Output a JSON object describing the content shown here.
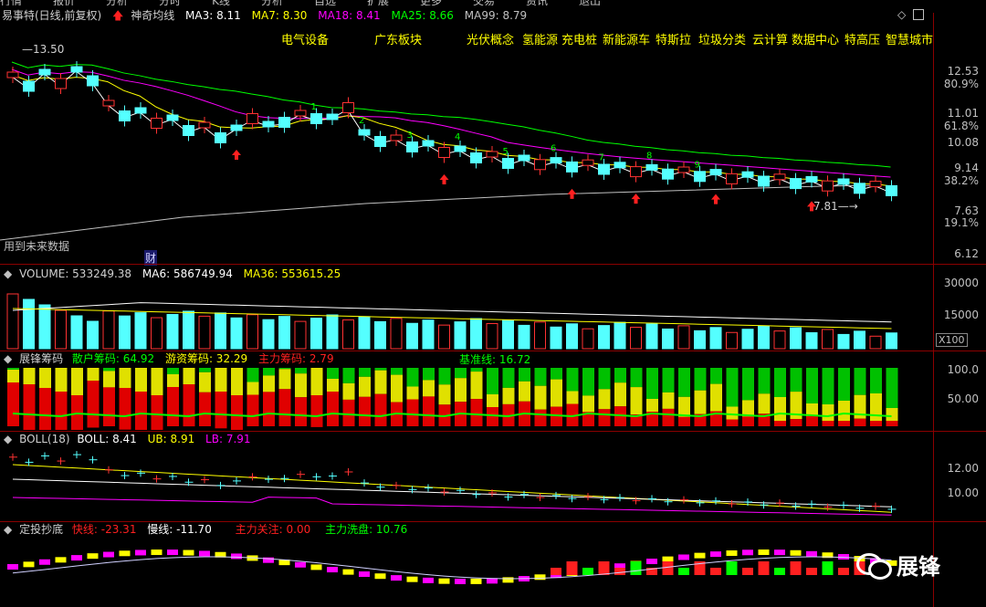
{
  "top_menu": [
    "行情",
    "报价",
    "分析",
    "分时",
    "K线",
    "分析",
    "自选",
    "扩展",
    "更多",
    "交易",
    "资讯",
    "退出"
  ],
  "main": {
    "stock": "易事特(日线,前复权)",
    "indicator": "神奇均线",
    "ma3": "MA3: 8.11",
    "ma7": "MA7: 8.30",
    "ma18": "MA18: 8.41",
    "ma25": "MA25: 8.66",
    "ma99": "MA99: 8.79",
    "high_label": "13.50",
    "low_label": "7.81",
    "future_label": "用到未来数据",
    "fin_label": "财",
    "concepts": [
      "电气设备",
      "广东板块",
      "光伏概念",
      "氢能源",
      "充电桩",
      "新能源车",
      "特斯拉",
      "垃圾分类",
      "云计算",
      "数据中心",
      "特高压",
      "智慧城市"
    ],
    "right_axis": [
      "12.53",
      "80.9%",
      "11.01",
      "61.8%",
      "10.08",
      "9.14",
      "38.2%",
      "7.63",
      "19.1%",
      "6.12"
    ]
  },
  "volume": {
    "title": "VOLUME: 533249.38",
    "ma6": "MA6: 586749.94",
    "ma36": "MA36: 553615.25",
    "axis": [
      "30000",
      "15000"
    ],
    "unit": "X100"
  },
  "chips": {
    "title": "展锋筹码",
    "retail": "散户筹码: 64.92",
    "hot": "游资筹码: 32.29",
    "main": "主力筹码: 2.79",
    "base": "基准线: 16.72",
    "axis": [
      "100.0",
      "50.00"
    ]
  },
  "boll": {
    "title": "BOLL(18)",
    "boll": "BOLL: 8.41",
    "ub": "UB: 8.91",
    "lb": "LB: 7.91",
    "axis": [
      "12.00",
      "10.00"
    ]
  },
  "dip": {
    "title": "定投抄底",
    "fast": "快线: -23.31",
    "slow": "慢线: -11.70",
    "focus": "主力关注: 0.00",
    "wash": "主力洗盘: 10.76"
  },
  "watermark": "展锋",
  "colors": {
    "up": "#ff3232",
    "down": "#54ffff",
    "ma3": "#ffffff",
    "ma7": "#ffff00",
    "ma18": "#ff00ff",
    "ma25": "#00ff00",
    "ma99": "#c0c0c0"
  }
}
